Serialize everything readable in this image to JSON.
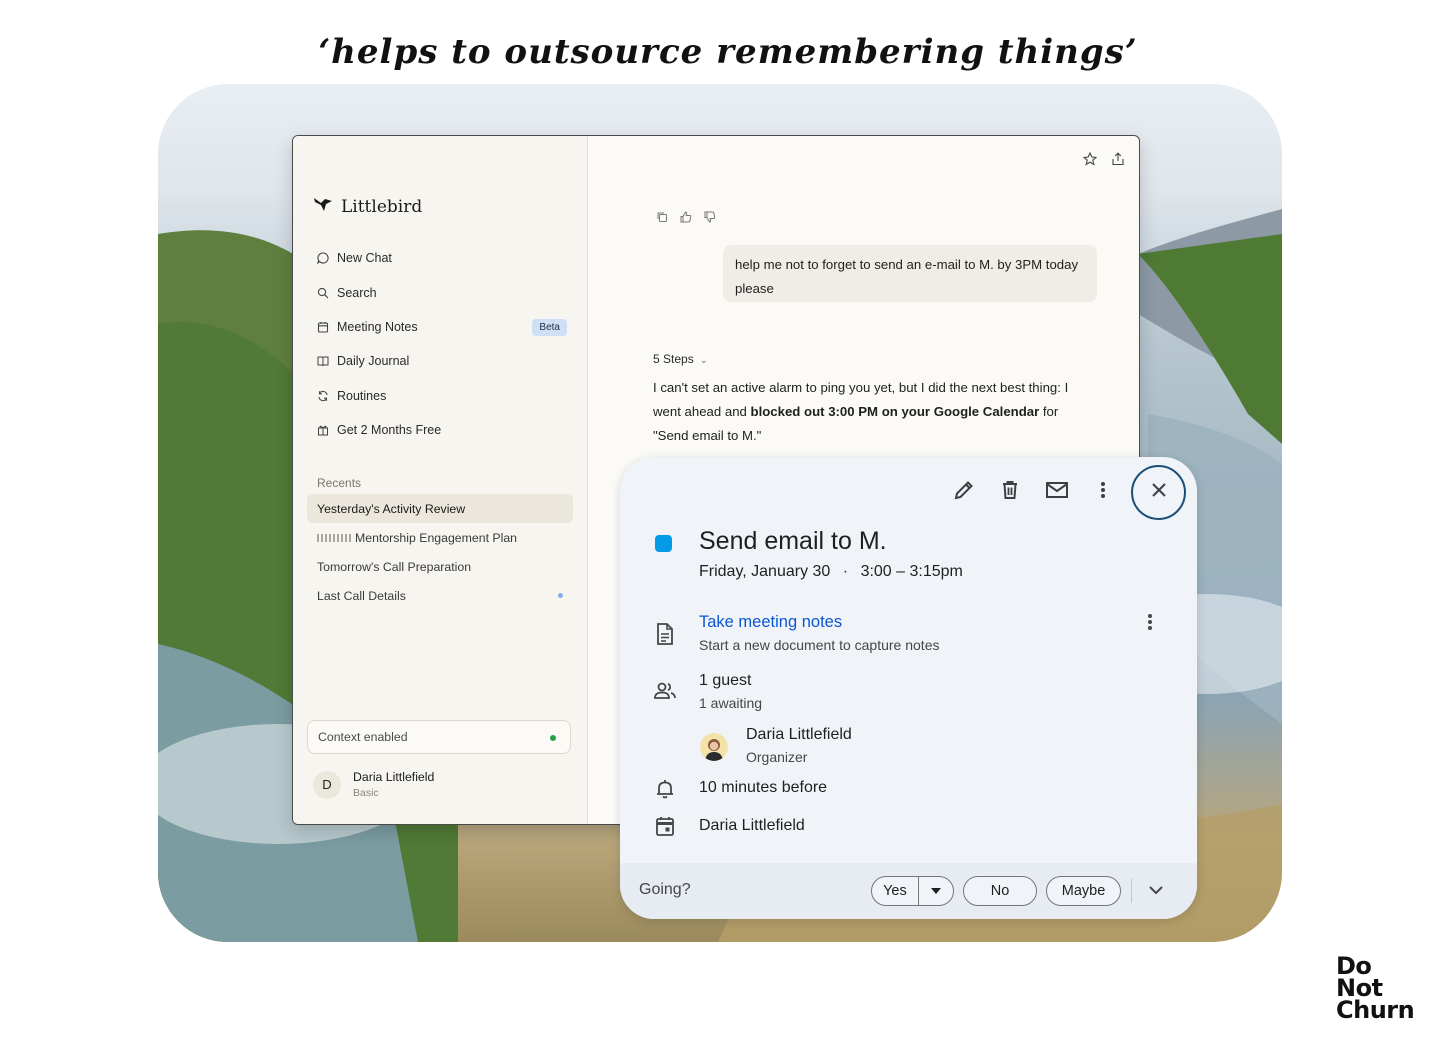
{
  "headline": "‘helps to outsource remembering things’",
  "app": {
    "brand": "Littlebird",
    "nav": [
      {
        "label": "New Chat",
        "icon": "chat-bubble-icon"
      },
      {
        "label": "Search",
        "icon": "search-icon"
      },
      {
        "label": "Meeting Notes",
        "icon": "calendar-icon",
        "badge": "Beta"
      },
      {
        "label": "Daily Journal",
        "icon": "book-icon"
      },
      {
        "label": "Routines",
        "icon": "refresh-icon"
      },
      {
        "label": "Get 2 Months Free",
        "icon": "gift-icon"
      }
    ],
    "recents_title": "Recents",
    "recents": [
      {
        "label": "Yesterday's Activity Review",
        "active": true
      },
      {
        "label": "Mentorship Engagement Plan",
        "prefix_blurred": true
      },
      {
        "label": "Tomorrow's Call Preparation"
      },
      {
        "label": "Last Call Details",
        "unread": true
      }
    ],
    "context_label": "Context enabled",
    "context_status_color": "#22a247",
    "user": {
      "initial": "D",
      "name": "Daria Littlefield",
      "plan": "Basic"
    },
    "chat": {
      "user_message": "help me not to forget to send an e-mail to M. by 3PM today please",
      "steps_label": "5 Steps",
      "answer_part1": "I can't set an active alarm to ping you yet, but I did the next best thing: I went ahead and ",
      "answer_bold": "blocked out 3:00 PM on your Google Calendar",
      "answer_part2": " for \"Send email to M.\""
    }
  },
  "event": {
    "title": "Send email to M.",
    "date": "Friday, January 30",
    "separator": "·",
    "time": "3:00 – 3:15pm",
    "color": "#039be5",
    "notes_link": "Take meeting notes",
    "notes_sub": "Start a new document to capture notes",
    "guests": "1 guest",
    "awaiting": "1 awaiting",
    "organizer_name": "Daria Littlefield",
    "organizer_role": "Organizer",
    "reminder": "10 minutes before",
    "calendar_name": "Daria Littlefield",
    "going_label": "Going?",
    "rsvp": {
      "yes": "Yes",
      "no": "No",
      "maybe": "Maybe"
    }
  },
  "logo": {
    "line1": "Do",
    "line2": "Not",
    "line3": "Churn"
  }
}
